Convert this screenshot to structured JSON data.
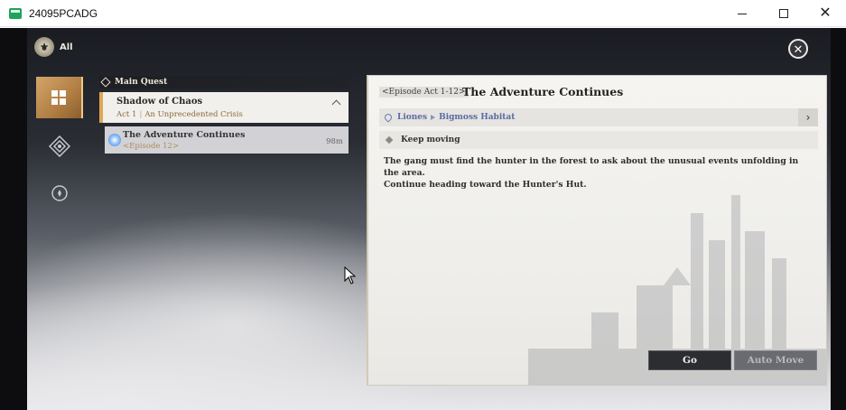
{
  "window": {
    "title": "24095PCADG",
    "minimize_icon": "minimize-icon",
    "maximize_icon": "maximize-icon",
    "close_icon": "close-icon"
  },
  "category": {
    "label": "All"
  },
  "tabs": [
    {
      "icon": "main-quest-icon",
      "active": true
    },
    {
      "icon": "diamond-compass-icon",
      "active": false
    },
    {
      "icon": "circle-target-icon",
      "active": false
    }
  ],
  "quest_list": {
    "header": "Main Quest",
    "quest": {
      "title": "Shadow of Chaos",
      "act": "Act 1",
      "subtitle": "An Unprecedented Crisis"
    },
    "episode": {
      "title": "The Adventure Continues",
      "subtitle": "<Episode 12>",
      "distance": "98m"
    }
  },
  "detail": {
    "episode_tag": "<Episode Act 1-12>",
    "title": "The Adventure Continues",
    "location": {
      "region": "Liones",
      "area": "Bigmoss Habitat"
    },
    "objective": "Keep moving",
    "description_line1": "The gang must find the hunter in the forest to ask about the unusual events unfolding in the area.",
    "description_line2": "Continue heading toward the Hunter's Hut.",
    "buttons": {
      "go": "Go",
      "auto_move": "Auto Move"
    }
  },
  "colors": {
    "accent_gold": "#e0a653",
    "location_blue": "#5a6aa5",
    "button_dark": "#2c2d31"
  }
}
